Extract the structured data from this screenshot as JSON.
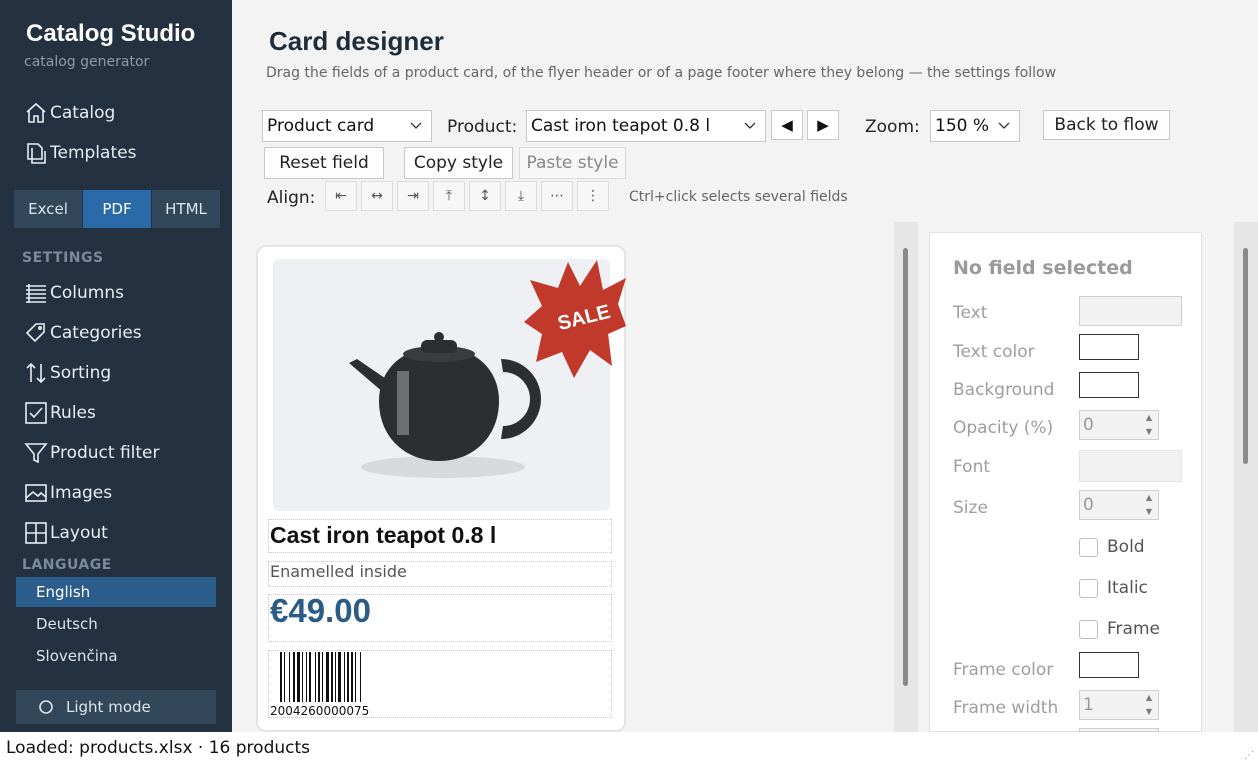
{
  "app": {
    "title": "Catalog Studio",
    "subtitle": "catalog generator"
  },
  "nav": [
    {
      "label": "Catalog",
      "icon": "home-icon"
    },
    {
      "label": "Templates",
      "icon": "templates-icon"
    }
  ],
  "formats": [
    "Excel",
    "PDF",
    "HTML"
  ],
  "active_format": "PDF",
  "settings_heading": "SETTINGS",
  "settings": [
    {
      "label": "Columns",
      "icon": "columns-icon"
    },
    {
      "label": "Categories",
      "icon": "tag-icon"
    },
    {
      "label": "Sorting",
      "icon": "sort-icon"
    },
    {
      "label": "Rules",
      "icon": "checkbox-icon"
    },
    {
      "label": "Product filter",
      "icon": "filter-icon"
    },
    {
      "label": "Images",
      "icon": "image-icon"
    },
    {
      "label": "Layout",
      "icon": "layout-icon"
    }
  ],
  "language_heading": "LANGUAGE",
  "languages": [
    "English",
    "Deutsch",
    "Slovenčina"
  ],
  "active_language": "English",
  "light_mode_label": "Light mode",
  "page": {
    "title": "Card designer",
    "subtitle": "Drag the fields of a product card, of the flyer header or of a page footer where they belong — the settings follow"
  },
  "toolbar": {
    "card_type": "Product card",
    "product_label": "Product:",
    "product_value": "Cast iron teapot 0.8 l",
    "prev": "◀",
    "next": "▶",
    "zoom_label": "Zoom:",
    "zoom_value": "150 %",
    "back_label": "Back to flow",
    "reset_label": "Reset field",
    "copy_label": "Copy style",
    "paste_label": "Paste style",
    "align_label": "Align:",
    "align_buttons": [
      "⇤",
      "↔",
      "⇥",
      "⤒",
      "↕",
      "⤓",
      "⋯",
      "⋮"
    ],
    "hint": "Ctrl+click selects several fields"
  },
  "card": {
    "badge": "SALE",
    "title": "Cast iron teapot 0.8 l",
    "description": "Enamelled inside",
    "price": "€49.00",
    "barcode": "2004260000075"
  },
  "panel": {
    "heading": "No field selected",
    "text_label": "Text",
    "text_color_label": "Text color",
    "background_label": "Background",
    "opacity_label": "Opacity (%)",
    "opacity_value": "0",
    "font_label": "Font",
    "size_label": "Size",
    "size_value": "0",
    "bold_label": "Bold",
    "italic_label": "Italic",
    "frame_label": "Frame",
    "frame_color_label": "Frame color",
    "frame_width_label": "Frame width",
    "frame_width_value": "1"
  },
  "status": "Loaded: products.xlsx · 16 products",
  "colors": {
    "sidebar": "#233140",
    "accent": "#2a6aa8",
    "price": "#2a5c86",
    "sale_badge": "#c0392b"
  }
}
